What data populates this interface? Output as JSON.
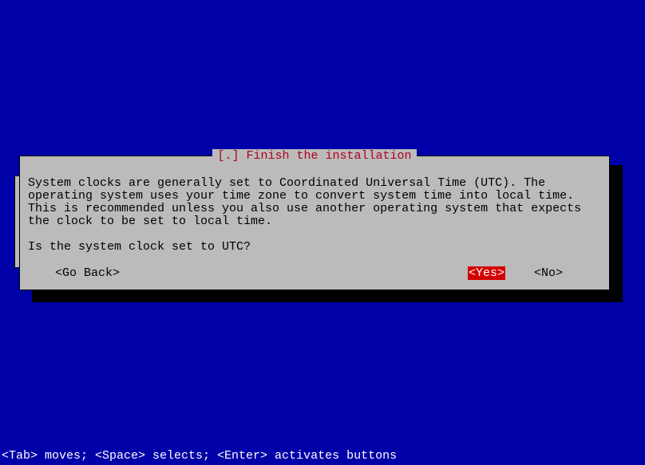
{
  "dialog": {
    "title": "[.] Finish the installation",
    "body": "System clocks are generally set to Coordinated Universal Time (UTC). The operating system uses your time zone to convert system time into local time. This is recommended unless you also use another operating system that expects the clock to be set to local time.",
    "question": "Is the system clock set to UTC?",
    "buttons": {
      "go_back": "<Go Back>",
      "yes": "<Yes>",
      "no": "<No>"
    }
  },
  "footer": {
    "hint": "<Tab> moves; <Space> selects; <Enter> activates buttons"
  }
}
